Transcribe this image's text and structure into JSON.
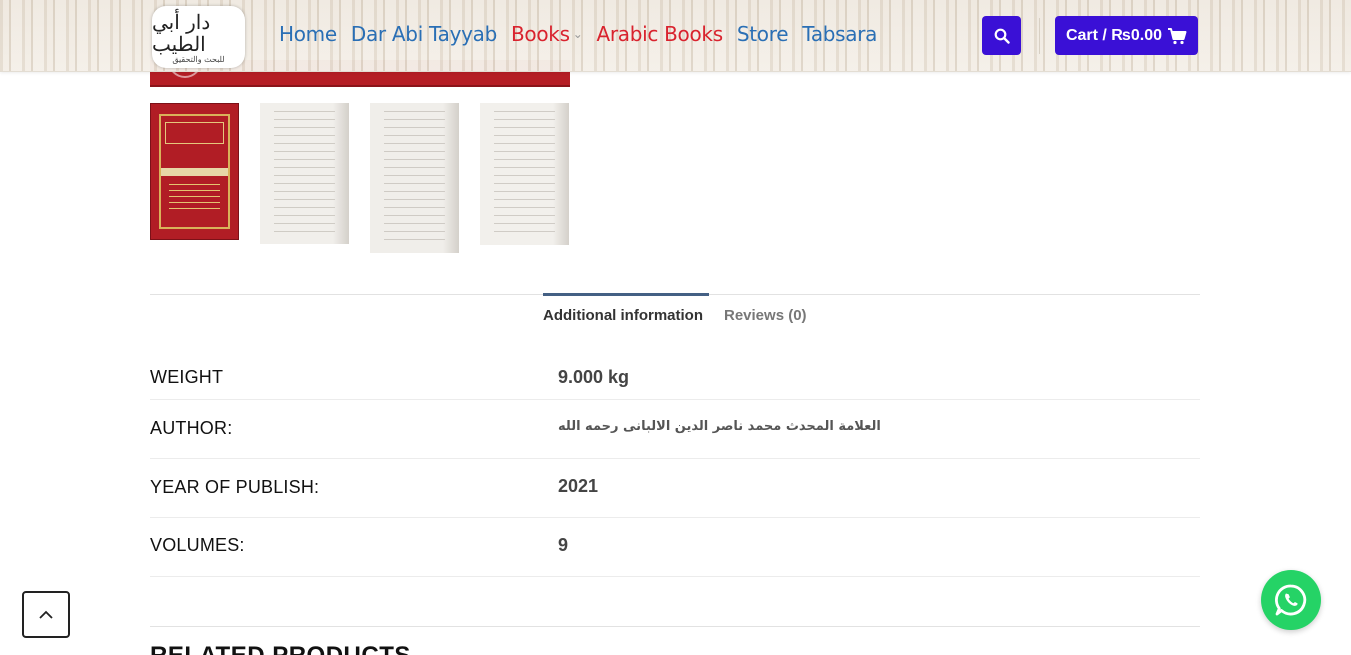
{
  "header": {
    "logo_text": "دار أبي الطيب",
    "logo_subtext": "للبحث والتحقيق",
    "nav": [
      {
        "label": "Home",
        "color": "#2a6fb5"
      },
      {
        "label": "Dar Abi Tayyab",
        "color": "#2a6fb5"
      },
      {
        "label": "Books",
        "color": "#d9232e",
        "has_dropdown": true
      },
      {
        "label": "Arabic Books",
        "color": "#d9232e"
      },
      {
        "label": "Store",
        "color": "#2a6fb5"
      },
      {
        "label": "Tabsara",
        "color": "#2a6fb5"
      }
    ],
    "search_icon": "search-icon",
    "cart_label": "Cart / ₨0.00",
    "cart_icon": "shopping-cart-icon",
    "accent_color": "#3a10d6"
  },
  "gallery": {
    "thumbnails": [
      {
        "label": "cover"
      },
      {
        "label": "page-1"
      },
      {
        "label": "page-2"
      },
      {
        "label": "page-3"
      }
    ]
  },
  "tabs": [
    {
      "label": "Additional information",
      "active": true
    },
    {
      "label": "Reviews (0)",
      "active": false
    }
  ],
  "attributes": [
    {
      "label": "WEIGHT",
      "value": "9.000 kg"
    },
    {
      "label": "AUTHOR:",
      "value": "العلامة المحدث محمد ناصر الدين الالبانى رحمه الله"
    },
    {
      "label": "YEAR OF PUBLISH:",
      "value": "2021"
    },
    {
      "label": "VOLUMES:",
      "value": "9"
    }
  ],
  "related_heading": "RELATED PRODUCTS",
  "back_to_top_icon": "chevron-up-icon",
  "whatsapp_icon": "whatsapp-icon"
}
